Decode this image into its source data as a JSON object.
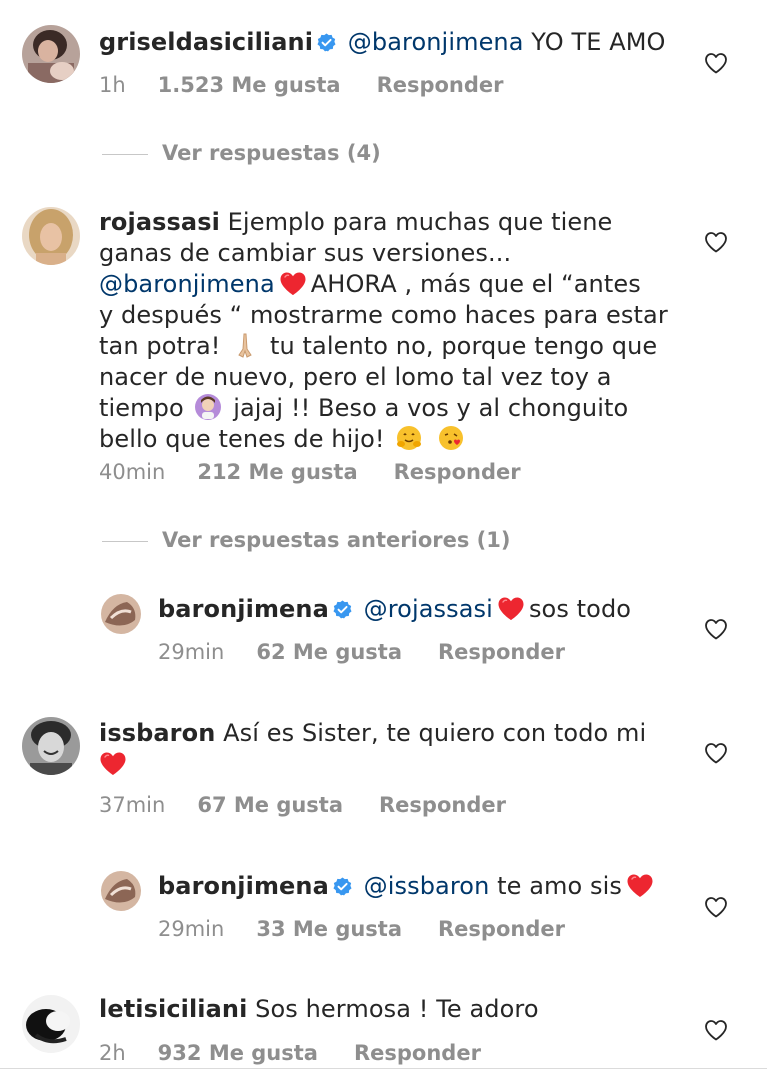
{
  "colors": {
    "text": "#262626",
    "secondary": "#8e8e8e",
    "mention": "#00376b",
    "verified": "#3897f0",
    "heart": "#ed2630"
  },
  "icons": {
    "like": "heart-outline-icon",
    "verified": "verified-badge-icon",
    "red_heart": "red-heart-emoji"
  },
  "comments": [
    {
      "user": "griseldasiciliani",
      "mention": "@baronjimena",
      "text": "YO TE AMO",
      "time": "1h",
      "likes": "1.523 Me gusta",
      "reply": "Responder"
    },
    {
      "view_replies": "Ver respuestas (4)"
    },
    {
      "user": "rojassasi",
      "line1": "Ejemplo para muchas que tiene",
      "line2": "ganas de cambiar sus versiones...",
      "mention": "@baronjimena",
      "line3_rest": "AHORA , más que el “antes",
      "line4": "y después “ mostrarme como haces para estar",
      "line5_a": "tan potra!",
      "line5_b": "tu talento no, porque tengo que",
      "line6": "nacer de nuevo, pero el lomo tal vez toy a",
      "line7_a": "tiempo",
      "line7_b": "jajaj !! Beso a vos y al chonguito",
      "line8": "bello que tenes de hijo!",
      "time": "40min",
      "likes": "212 Me gusta",
      "reply": "Responder"
    },
    {
      "view_replies": "Ver respuestas anteriores (1)"
    },
    {
      "user": "baronjimena",
      "mention": "@rojassasi",
      "text": "sos todo",
      "time": "29min",
      "likes": "62 Me gusta",
      "reply": "Responder"
    },
    {
      "user": "issbaron",
      "text": "Así es Sister, te quiero con todo mi",
      "time": "37min",
      "likes": "67 Me gusta",
      "reply": "Responder"
    },
    {
      "user": "baronjimena",
      "mention": "@issbaron",
      "text": "te amo sis",
      "time": "29min",
      "likes": "33 Me gusta",
      "reply": "Responder"
    },
    {
      "user": "letisiciliani",
      "text": "Sos hermosa ! Te adoro",
      "time": "2h",
      "likes": "932 Me gusta",
      "reply": "Responder"
    }
  ]
}
